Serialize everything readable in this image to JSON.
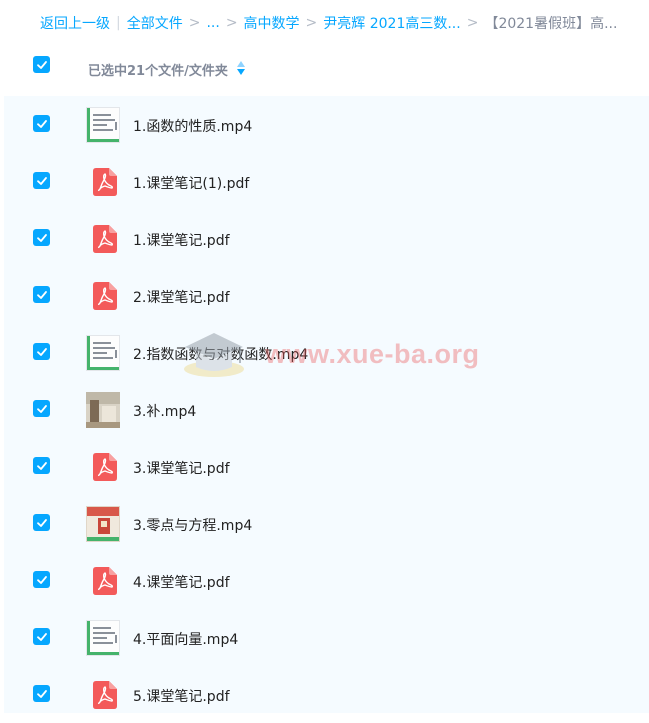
{
  "breadcrumb": {
    "back": "返回上一级",
    "all_files": "全部文件",
    "ellipsis": "...",
    "level1": "高中数学",
    "level2": "尹亮辉 2021高三数...",
    "current": "【2021暑假班】高..."
  },
  "header": {
    "selected_text": "已选中21个文件/文件夹",
    "select_all_checked": true
  },
  "files": [
    {
      "name": "1.函数的性质.mp4",
      "type": "video",
      "checked": true
    },
    {
      "name": "1.课堂笔记(1).pdf",
      "type": "pdf",
      "checked": true
    },
    {
      "name": "1.课堂笔记.pdf",
      "type": "pdf",
      "checked": true
    },
    {
      "name": "2.课堂笔记.pdf",
      "type": "pdf",
      "checked": true
    },
    {
      "name": "2.指数函数与对数函数.mp4",
      "type": "video",
      "checked": true
    },
    {
      "name": "3.补.mp4",
      "type": "video-photo",
      "checked": true
    },
    {
      "name": "3.课堂笔记.pdf",
      "type": "pdf",
      "checked": true
    },
    {
      "name": "3.零点与方程.mp4",
      "type": "video-red",
      "checked": true
    },
    {
      "name": "4.课堂笔记.pdf",
      "type": "pdf",
      "checked": true
    },
    {
      "name": "4.平面向量.mp4",
      "type": "video",
      "checked": true
    },
    {
      "name": "5.课堂笔记.pdf",
      "type": "pdf",
      "checked": true
    }
  ],
  "watermark": {
    "text": "www.xue-ba.org"
  },
  "colors": {
    "accent": "#06a7ff",
    "pdf": "#f35a5a",
    "list_bg": "#f5fbff"
  }
}
